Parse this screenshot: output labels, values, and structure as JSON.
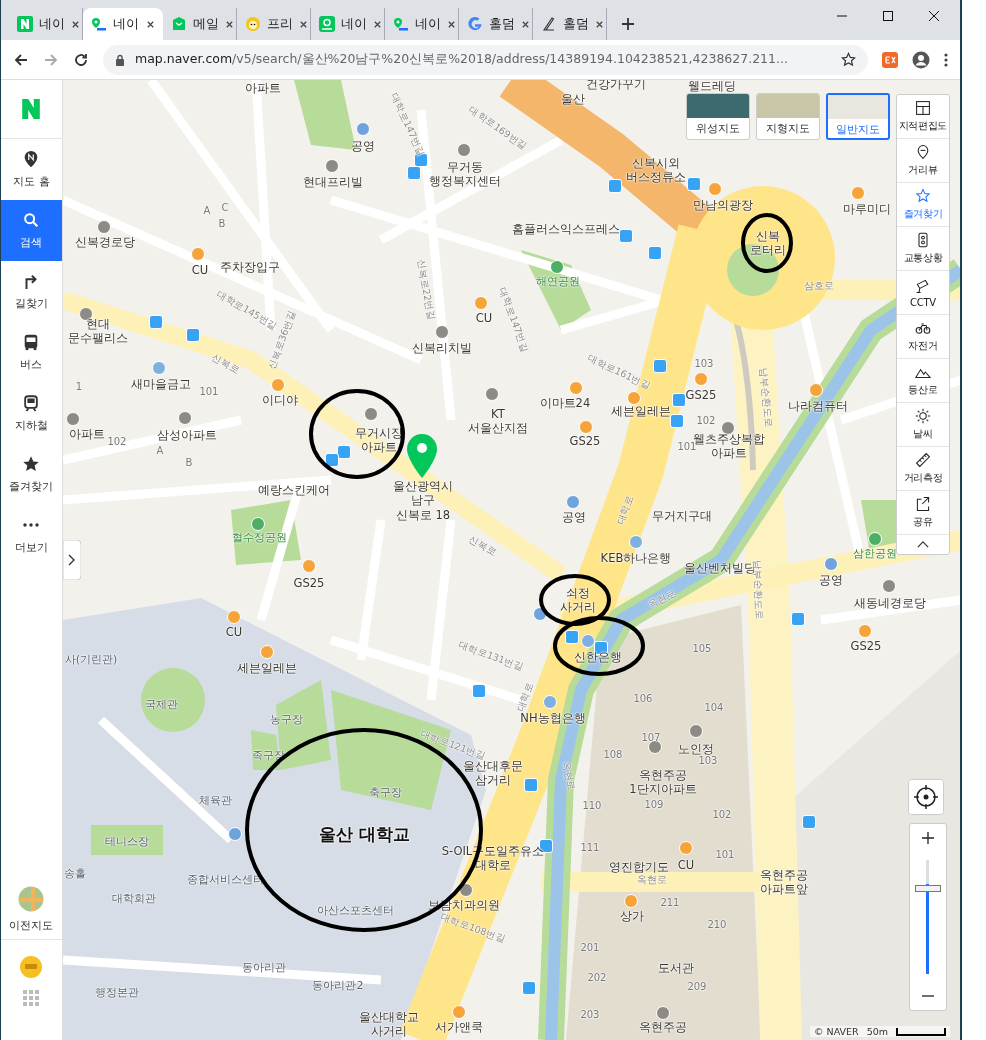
{
  "browser": {
    "tabs": [
      {
        "title": "네이",
        "selected": false
      },
      {
        "title": "네이",
        "selected": true
      },
      {
        "title": "메일",
        "selected": false
      },
      {
        "title": "프리",
        "selected": false
      },
      {
        "title": "네이",
        "selected": false
      },
      {
        "title": "네이",
        "selected": false
      },
      {
        "title": "홀덤",
        "selected": false
      },
      {
        "title": "홀덤",
        "selected": false
      }
    ],
    "url_host": "map.naver.com",
    "url_path": "/v5/search/울산%20남구%20신복로%2018/address/14389194.104238521,4238627.211..."
  },
  "sidebar": {
    "items": [
      {
        "label": "지도 홈",
        "selected": false
      },
      {
        "label": "검색",
        "selected": true
      },
      {
        "label": "길찾기",
        "selected": false
      },
      {
        "label": "버스",
        "selected": false
      },
      {
        "label": "지하철",
        "selected": false
      },
      {
        "label": "즐겨찾기",
        "selected": false
      },
      {
        "label": "더보기",
        "selected": false
      }
    ],
    "previous_map": "이전지도"
  },
  "map_types": [
    {
      "label": "위성지도",
      "selected": false
    },
    {
      "label": "지형지도",
      "selected": false
    },
    {
      "label": "일반지도",
      "selected": true
    }
  ],
  "map_tools": [
    {
      "label": "지적편집도",
      "selected": false
    },
    {
      "label": "거리뷰",
      "selected": false
    },
    {
      "label": "즐겨찾기",
      "selected": true
    },
    {
      "label": "교통상황",
      "selected": false
    },
    {
      "label": "CCTV",
      "selected": false
    },
    {
      "label": "자전거",
      "selected": false
    },
    {
      "label": "등산로",
      "selected": false
    },
    {
      "label": "날씨",
      "selected": false
    },
    {
      "label": "거리측정",
      "selected": false
    },
    {
      "label": "공유",
      "selected": false
    }
  ],
  "zoom": {
    "level": 0.74
  },
  "attribution": "© NAVER",
  "scale": "50m",
  "map_labels": [
    {
      "kind": "place",
      "lines": [
        "아파트"
      ]
    },
    {
      "kind": "place",
      "lines": [
        "공영"
      ]
    },
    {
      "kind": "place",
      "lines": [
        "현대프리빌"
      ]
    },
    {
      "kind": "place",
      "lines": [
        "무거동",
        "행정복지센터"
      ]
    },
    {
      "kind": "place",
      "lines": [
        "울산"
      ]
    },
    {
      "kind": "place",
      "lines": [
        "건강가꾸기"
      ]
    },
    {
      "kind": "place",
      "lines": [
        "웰드레딩"
      ]
    },
    {
      "kind": "place",
      "lines": [
        "신복시외",
        "버스정류소"
      ]
    },
    {
      "kind": "place",
      "lines": [
        "만남의광장"
      ]
    },
    {
      "kind": "place",
      "lines": [
        "마루미디"
      ]
    },
    {
      "kind": "place",
      "lines": [
        "신복",
        "로터리"
      ]
    },
    {
      "kind": "place",
      "lines": [
        "홈플러스익스프레스"
      ]
    },
    {
      "kind": "park",
      "lines": [
        "해연공원"
      ]
    },
    {
      "kind": "place",
      "lines": [
        "신복경로당"
      ]
    },
    {
      "kind": "place",
      "lines": [
        "CU"
      ]
    },
    {
      "kind": "place",
      "lines": [
        "주차장입구"
      ]
    },
    {
      "kind": "place",
      "lines": [
        "CU"
      ]
    },
    {
      "kind": "place",
      "lines": [
        "현대",
        "문수팰리스"
      ]
    },
    {
      "kind": "place",
      "lines": [
        "신복리치빌"
      ]
    },
    {
      "kind": "place",
      "lines": [
        "새마을금고"
      ]
    },
    {
      "kind": "place",
      "lines": [
        "이디야"
      ]
    },
    {
      "kind": "place",
      "lines": [
        "KT",
        "서울산지점"
      ]
    },
    {
      "kind": "place",
      "lines": [
        "이마트24"
      ]
    },
    {
      "kind": "place",
      "lines": [
        "세븐일레븐"
      ]
    },
    {
      "kind": "place",
      "lines": [
        "GS25"
      ]
    },
    {
      "kind": "place",
      "lines": [
        "GS25"
      ]
    },
    {
      "kind": "place",
      "lines": [
        "나라컴퓨터"
      ]
    },
    {
      "kind": "place",
      "lines": [
        "웰츠주상복합",
        "아파트"
      ]
    },
    {
      "kind": "place",
      "lines": [
        "아파트"
      ]
    },
    {
      "kind": "place",
      "lines": [
        "삼성아파트"
      ]
    },
    {
      "kind": "place",
      "lines": [
        "무거시장",
        "아파트"
      ]
    },
    {
      "kind": "place",
      "lines": [
        "예랑스킨케어"
      ]
    },
    {
      "kind": "place",
      "lines": [
        "울산광역시",
        "남구",
        "신복로 18"
      ]
    },
    {
      "kind": "place",
      "lines": [
        "공영"
      ]
    },
    {
      "kind": "place",
      "lines": [
        "무거지구대"
      ]
    },
    {
      "kind": "park",
      "lines": [
        "혈수정공원"
      ]
    },
    {
      "kind": "place",
      "lines": [
        "KEB하나은행"
      ]
    },
    {
      "kind": "place",
      "lines": [
        "울산벤처빌딩"
      ]
    },
    {
      "kind": "park",
      "lines": [
        "삼한공원"
      ]
    },
    {
      "kind": "place",
      "lines": [
        "공영"
      ]
    },
    {
      "kind": "place",
      "lines": [
        "새동네경로당"
      ]
    },
    {
      "kind": "place",
      "lines": [
        "GS25"
      ]
    },
    {
      "kind": "place",
      "lines": [
        "GS25"
      ]
    },
    {
      "kind": "place",
      "lines": [
        "CU"
      ]
    },
    {
      "kind": "place",
      "lines": [
        "세븐일레븐"
      ]
    },
    {
      "kind": "place",
      "lines": [
        "쇠정",
        "사거리"
      ]
    },
    {
      "kind": "place",
      "lines": [
        "신한은행"
      ]
    },
    {
      "kind": "campus-building",
      "lines": [
        "사(기린관)"
      ]
    },
    {
      "kind": "campus-building",
      "lines": [
        "국제관"
      ]
    },
    {
      "kind": "campus-building",
      "lines": [
        "농구장"
      ]
    },
    {
      "kind": "campus-building",
      "lines": [
        "족구장"
      ]
    },
    {
      "kind": "campus-building",
      "lines": [
        "축구장"
      ]
    },
    {
      "kind": "campus",
      "lines": [
        "울산 대학교"
      ]
    },
    {
      "kind": "campus-building",
      "lines": [
        "체육관"
      ]
    },
    {
      "kind": "campus-building",
      "lines": [
        "테니스장"
      ]
    },
    {
      "kind": "place",
      "lines": [
        "NH농협은행"
      ]
    },
    {
      "kind": "place",
      "lines": [
        "울산대후문",
        "삼거리"
      ]
    },
    {
      "kind": "place",
      "lines": [
        "S-OIL구도일주유소",
        "대학로"
      ]
    },
    {
      "kind": "campus-building",
      "lines": [
        "송홀"
      ]
    },
    {
      "kind": "campus-building",
      "lines": [
        "종합서비스센터"
      ]
    },
    {
      "kind": "campus-building",
      "lines": [
        "대학회관"
      ]
    },
    {
      "kind": "campus-building",
      "lines": [
        "아산스포츠센터"
      ]
    },
    {
      "kind": "place",
      "lines": [
        "보람치과의원"
      ]
    },
    {
      "kind": "campus-building",
      "lines": [
        "동아리관"
      ]
    },
    {
      "kind": "campus-building",
      "lines": [
        "동아리관2"
      ]
    },
    {
      "kind": "campus-building",
      "lines": [
        "행정본관"
      ]
    },
    {
      "kind": "place",
      "lines": [
        "울산대학교",
        "사거리"
      ]
    },
    {
      "kind": "place",
      "lines": [
        "서가앤쿡"
      ]
    },
    {
      "kind": "place",
      "lines": [
        "노인정"
      ]
    },
    {
      "kind": "place",
      "lines": [
        "옥현주공",
        "1단지아파트"
      ]
    },
    {
      "kind": "place",
      "lines": [
        "영진합기도"
      ]
    },
    {
      "kind": "place",
      "lines": [
        "CU"
      ]
    },
    {
      "kind": "place",
      "lines": [
        "옥현주공",
        "아파트앞"
      ]
    },
    {
      "kind": "place",
      "lines": [
        "상가"
      ]
    },
    {
      "kind": "place",
      "lines": [
        "도서관"
      ]
    },
    {
      "kind": "place",
      "lines": [
        "옥현주공"
      ]
    },
    {
      "kind": "number",
      "lines": [
        "105"
      ]
    },
    {
      "kind": "number",
      "lines": [
        "104"
      ]
    },
    {
      "kind": "number",
      "lines": [
        "106"
      ]
    },
    {
      "kind": "number",
      "lines": [
        "107"
      ]
    },
    {
      "kind": "number",
      "lines": [
        "108"
      ]
    },
    {
      "kind": "number",
      "lines": [
        "103"
      ]
    },
    {
      "kind": "number",
      "lines": [
        "109"
      ]
    },
    {
      "kind": "number",
      "lines": [
        "102"
      ]
    },
    {
      "kind": "number",
      "lines": [
        "101"
      ]
    },
    {
      "kind": "number",
      "lines": [
        "110"
      ]
    },
    {
      "kind": "number",
      "lines": [
        "111"
      ]
    },
    {
      "kind": "number",
      "lines": [
        "211"
      ]
    },
    {
      "kind": "number",
      "lines": [
        "210"
      ]
    },
    {
      "kind": "number",
      "lines": [
        "201"
      ]
    },
    {
      "kind": "number",
      "lines": [
        "202"
      ]
    },
    {
      "kind": "number",
      "lines": [
        "209"
      ]
    },
    {
      "kind": "number",
      "lines": [
        "203"
      ]
    },
    {
      "kind": "number",
      "lines": [
        "103"
      ]
    },
    {
      "kind": "number",
      "lines": [
        "102"
      ]
    },
    {
      "kind": "number",
      "lines": [
        "101"
      ]
    },
    {
      "kind": "number",
      "lines": [
        "101"
      ]
    },
    {
      "kind": "number",
      "lines": [
        "102"
      ]
    },
    {
      "kind": "number",
      "lines": [
        "1"
      ]
    },
    {
      "kind": "number",
      "lines": [
        "A"
      ]
    },
    {
      "kind": "number",
      "lines": [
        "C"
      ]
    },
    {
      "kind": "number",
      "lines": [
        "B"
      ]
    },
    {
      "kind": "number",
      "lines": [
        "A"
      ]
    },
    {
      "kind": "number",
      "lines": [
        "B"
      ]
    },
    {
      "kind": "road",
      "lines": [
        "대학로169번길"
      ]
    },
    {
      "kind": "road",
      "lines": [
        "대학로147번길"
      ]
    },
    {
      "kind": "road",
      "lines": [
        "대학로147번길"
      ]
    },
    {
      "kind": "road",
      "lines": [
        "대학로145번길"
      ]
    },
    {
      "kind": "road",
      "lines": [
        "대학로161번길"
      ]
    },
    {
      "kind": "road",
      "lines": [
        "신복로"
      ]
    },
    {
      "kind": "road",
      "lines": [
        "신복로"
      ]
    },
    {
      "kind": "road",
      "lines": [
        "삼호로"
      ]
    },
    {
      "kind": "road",
      "lines": [
        "옥현로"
      ]
    },
    {
      "kind": "road",
      "lines": [
        "옥현로"
      ]
    },
    {
      "kind": "road",
      "lines": [
        "남부순환도로"
      ]
    },
    {
      "kind": "road",
      "lines": [
        "남부순환도로"
      ]
    },
    {
      "kind": "road",
      "lines": [
        "대학로121번길"
      ]
    },
    {
      "kind": "road",
      "lines": [
        "대학로131번길"
      ]
    },
    {
      "kind": "road",
      "lines": [
        "대학로108번길"
      ]
    },
    {
      "kind": "road",
      "lines": [
        "대학로"
      ]
    },
    {
      "kind": "road",
      "lines": [
        "대학로"
      ]
    },
    {
      "kind": "road",
      "lines": [
        "옥현로"
      ]
    },
    {
      "kind": "road",
      "lines": [
        "신복로22번길"
      ]
    },
    {
      "kind": "road",
      "lines": [
        "신복로36번길"
      ]
    }
  ]
}
